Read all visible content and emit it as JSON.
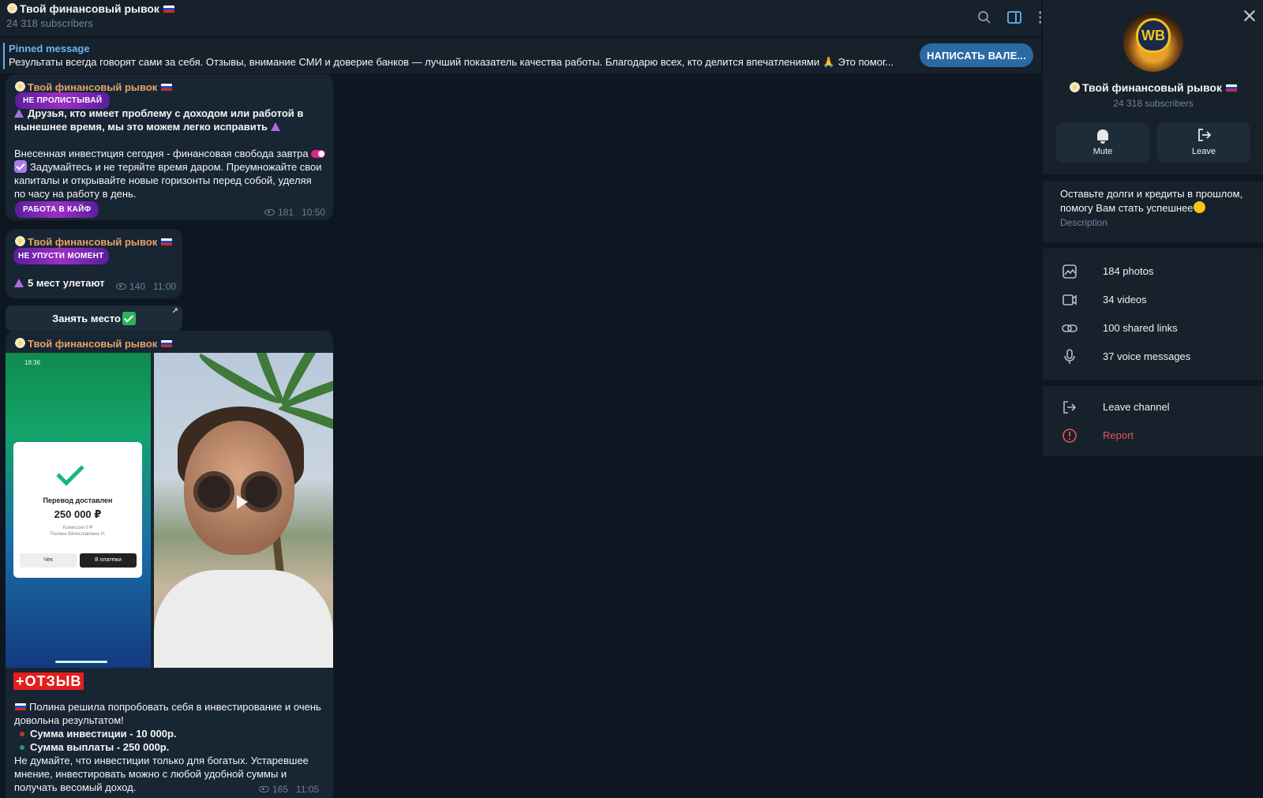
{
  "header": {
    "title": "Твой финансовый рывок",
    "subscribers": "24 318 subscribers",
    "icons": [
      "search-icon",
      "sidebar-toggle-icon",
      "more-vertical-icon"
    ]
  },
  "pinned": {
    "label": "Pinned message",
    "text": "Результаты всегда говорят сами за себя. Отзывы, внимание СМИ и доверие банков — лучший показатель качества работы.  Благодарю всех, кто делится впечатлениями 🙏 Это помог...",
    "button": "НАПИСАТЬ ВАЛЕ..."
  },
  "messages": [
    {
      "author": "Твой финансовый рывок",
      "sticker_top": "НЕ ПРОЛИСТЫВАЙ",
      "line1": "Друзья, кто имеет проблему с доходом или работой в",
      "line2": "нынешнее время, мы это можем легко исправить",
      "line3": "Внесенная инвестиция сегодня - финансовая свобода завтра",
      "line4": "Задумайтесь и не теряйте время даром. Преумножайте свои",
      "line5": "капиталы и открывайте новые горизонты перед собой, уделяя",
      "line6": "по часу на работу в день.",
      "sticker_bottom": "РАБОТА В КАЙФ",
      "views": "181",
      "time": "10:50"
    },
    {
      "author": "Твой финансовый рывок",
      "sticker": "НЕ УПУСТИ МОМЕНТ",
      "text": "5 мест улетают",
      "views": "140",
      "time": "11:00",
      "button": "Занять место"
    },
    {
      "author": "Твой финансовый рывок",
      "receipt": {
        "status_time": "18:36",
        "title": "Перевод доставлен",
        "amount": "250 000 ₽",
        "commission": "Комиссия 0 ₽",
        "recipient": "Полина Вячеславовна Н.",
        "btn_check": "Чек",
        "btn_payments": "В платежи"
      },
      "review_label": "+ОТЗЫВ",
      "line1": "Полина решила попробовать себя в инвестирование и очень",
      "line2": "довольна результатом!",
      "bullet1": "Сумма инвестиции - 10 000р.",
      "bullet2": "Сумма выплаты - 250 000р.",
      "line3": "Не думайте, что инвестиции только для богатых. Устаревшее",
      "line4": "мнение, инвестировать можно с любой удобной суммы и",
      "line5": "получать весомый доход.",
      "views": "165",
      "time": "11:05"
    }
  ],
  "panel": {
    "name": "Твой финансовый рывок",
    "subscribers": "24 318 subscribers",
    "avatar_text": "WB",
    "mute_label": "Mute",
    "leave_label": "Leave",
    "description_line1": "Оставьте долги и кредиты в прошлом,",
    "description_line2": "помогу Вам стать успешнее",
    "description_label": "Description",
    "media": [
      {
        "icon": "photo-icon",
        "label": "184 photos"
      },
      {
        "icon": "video-icon",
        "label": "34 videos"
      },
      {
        "icon": "link-icon",
        "label": "100 shared links"
      },
      {
        "icon": "microphone-icon",
        "label": "37 voice messages"
      }
    ],
    "leave_channel": "Leave channel",
    "report": "Report",
    "colors": {
      "report": "#e5535e",
      "accent": "#6ab3f3",
      "author": "#e8a266"
    }
  }
}
